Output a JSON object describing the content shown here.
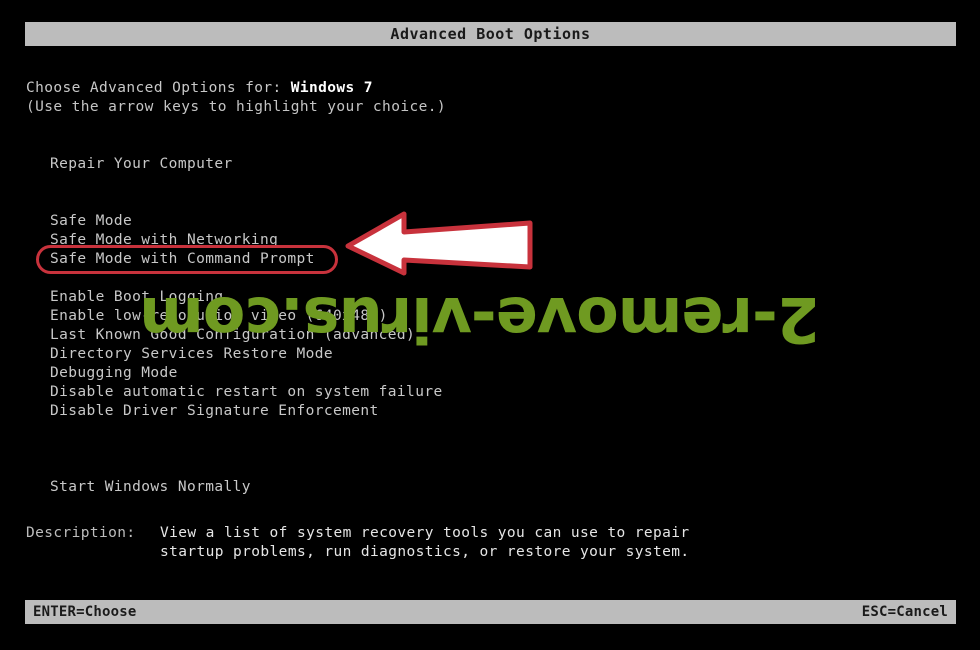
{
  "window": {
    "title": "Advanced Boot Options"
  },
  "header": {
    "prompt_prefix": "Choose Advanced Options for: ",
    "os_name": "Windows 7",
    "hint": "(Use the arrow keys to highlight your choice.)"
  },
  "menu": {
    "items": [
      {
        "label": "Repair Your Computer",
        "selected": true
      },
      {
        "label": "",
        "spacer": true
      },
      {
        "label": "",
        "spacer": true
      },
      {
        "label": "Safe Mode",
        "selected": false
      },
      {
        "label": "Safe Mode with Networking",
        "selected": false
      },
      {
        "label": "Safe Mode with Command Prompt",
        "selected": false
      },
      {
        "label": "",
        "spacer": true
      },
      {
        "label": "Enable Boot Logging",
        "selected": false
      },
      {
        "label": "Enable low-resolution video (640x480)",
        "selected": false
      },
      {
        "label": "Last Known Good Configuration (advanced)",
        "selected": false
      },
      {
        "label": "Directory Services Restore Mode",
        "selected": false
      },
      {
        "label": "Debugging Mode",
        "selected": false
      },
      {
        "label": "Disable automatic restart on system failure",
        "selected": false
      },
      {
        "label": "Disable Driver Signature Enforcement",
        "selected": false
      },
      {
        "label": "",
        "spacer": true
      },
      {
        "label": "",
        "spacer": true
      },
      {
        "label": "",
        "spacer": true
      },
      {
        "label": "Start Windows Normally",
        "selected": false
      }
    ]
  },
  "annotation": {
    "highlighted_item": "Safe Mode with Command Prompt",
    "arrow_icon": "left-arrow-icon",
    "arrow_fill": "#ffffff",
    "arrow_stroke": "#c8323c",
    "box_color": "#c8323c"
  },
  "watermark": {
    "text": "2-remove-virus.com",
    "color": "#6f9a21"
  },
  "description": {
    "label": "Description:",
    "line1": "View a list of system recovery tools you can use to repair",
    "line2": "startup problems, run diagnostics, or restore your system."
  },
  "footer": {
    "enter_key": "ENTER=Choose",
    "esc_key": "ESC=Cancel"
  }
}
